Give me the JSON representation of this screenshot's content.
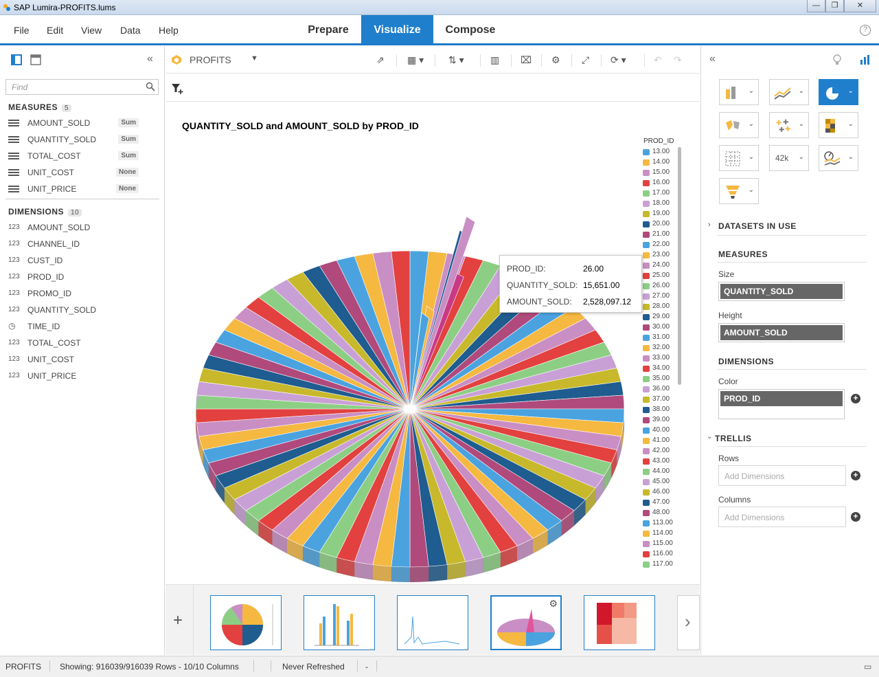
{
  "window": {
    "title": "SAP Lumira-PROFITS.lums"
  },
  "menu": {
    "items": [
      "File",
      "Edit",
      "View",
      "Data",
      "Help"
    ]
  },
  "tabs": [
    {
      "label": "Prepare"
    },
    {
      "label": "Visualize"
    },
    {
      "label": "Compose"
    }
  ],
  "toolbar": {
    "dataset": "PROFITS"
  },
  "left": {
    "find_placeholder": "Find",
    "measures_label": "MEASURES",
    "measures_count": "5",
    "measures": [
      {
        "name": "AMOUNT_SOLD",
        "agg": "Sum"
      },
      {
        "name": "QUANTITY_SOLD",
        "agg": "Sum"
      },
      {
        "name": "TOTAL_COST",
        "agg": "Sum"
      },
      {
        "name": "UNIT_COST",
        "agg": "None"
      },
      {
        "name": "UNIT_PRICE",
        "agg": "None"
      }
    ],
    "dimensions_label": "DIMENSIONS",
    "dimensions_count": "10",
    "dimensions": [
      {
        "name": "AMOUNT_SOLD",
        "icon": "123"
      },
      {
        "name": "CHANNEL_ID",
        "icon": "123"
      },
      {
        "name": "CUST_ID",
        "icon": "123"
      },
      {
        "name": "PROD_ID",
        "icon": "123"
      },
      {
        "name": "PROMO_ID",
        "icon": "123"
      },
      {
        "name": "QUANTITY_SOLD",
        "icon": "123"
      },
      {
        "name": "TIME_ID",
        "icon": "clock-icon"
      },
      {
        "name": "TOTAL_COST",
        "icon": "123"
      },
      {
        "name": "UNIT_COST",
        "icon": "123"
      },
      {
        "name": "UNIT_PRICE",
        "icon": "123"
      }
    ]
  },
  "chart_data": {
    "type": "pie",
    "title": "QUANTITY_SOLD and AMOUNT_SOLD by PROD_ID",
    "legend_title": "PROD_ID",
    "legend_position": "right",
    "legend": [
      "13.00",
      "14.00",
      "15.00",
      "16.00",
      "17.00",
      "18.00",
      "19.00",
      "20.00",
      "21.00",
      "22.00",
      "23.00",
      "24.00",
      "25.00",
      "26.00",
      "27.00",
      "28.00",
      "29.00",
      "30.00",
      "31.00",
      "32.00",
      "33.00",
      "34.00",
      "35.00",
      "36.00",
      "37.00",
      "38.00",
      "39.00",
      "40.00",
      "41.00",
      "42.00",
      "43.00",
      "44.00",
      "45.00",
      "46.00",
      "47.00",
      "48.00",
      "113.00",
      "114.00",
      "115.00",
      "116.00",
      "117.00"
    ],
    "palette": [
      "#4aa3df",
      "#f5b841",
      "#c98ec4",
      "#e2413f",
      "#8ccf84",
      "#c9a0d6",
      "#c7b92b",
      "#1f5c8f",
      "#b04a7c",
      "#4aa3df",
      "#f5b841",
      "#c98ec4",
      "#e2413f",
      "#8ccf84",
      "#c9a0d6",
      "#c7b92b",
      "#1f5c8f",
      "#b04a7c",
      "#4aa3df",
      "#f5b841",
      "#c98ec4",
      "#e2413f",
      "#8ccf84",
      "#c9a0d6",
      "#c7b92b",
      "#1f5c8f",
      "#b04a7c",
      "#4aa3df",
      "#f5b841",
      "#c98ec4",
      "#e2413f",
      "#8ccf84",
      "#c9a0d6",
      "#c7b92b",
      "#1f5c8f",
      "#b04a7c",
      "#4aa3df",
      "#f5b841",
      "#c98ec4",
      "#e2413f",
      "#8ccf84"
    ],
    "tooltip": {
      "PROD_ID": "26.00",
      "QUANTITY_SOLD": "15,651.00",
      "AMOUNT_SOLD": "2,528,097.12"
    }
  },
  "tooltip_labels": {
    "a": "PROD_ID:",
    "b": "QUANTITY_SOLD:",
    "c": "AMOUNT_SOLD:"
  },
  "right": {
    "datasets_in_use": "DATASETS IN USE",
    "measures": "MEASURES",
    "size_label": "Size",
    "size_value": "QUANTITY_SOLD",
    "height_label": "Height",
    "height_value": "AMOUNT_SOLD",
    "dimensions": "DIMENSIONS",
    "color_label": "Color",
    "color_value": "PROD_ID",
    "trellis": "TRELLIS",
    "rows_label": "Rows",
    "columns_label": "Columns",
    "add_dims": "Add Dimensions",
    "kpi_label": "42k"
  },
  "status": {
    "dataset": "PROFITS",
    "rows": "Showing: 916039/916039 Rows - 10/10 Columns",
    "refresh": "Never Refreshed",
    "dash": "-"
  }
}
